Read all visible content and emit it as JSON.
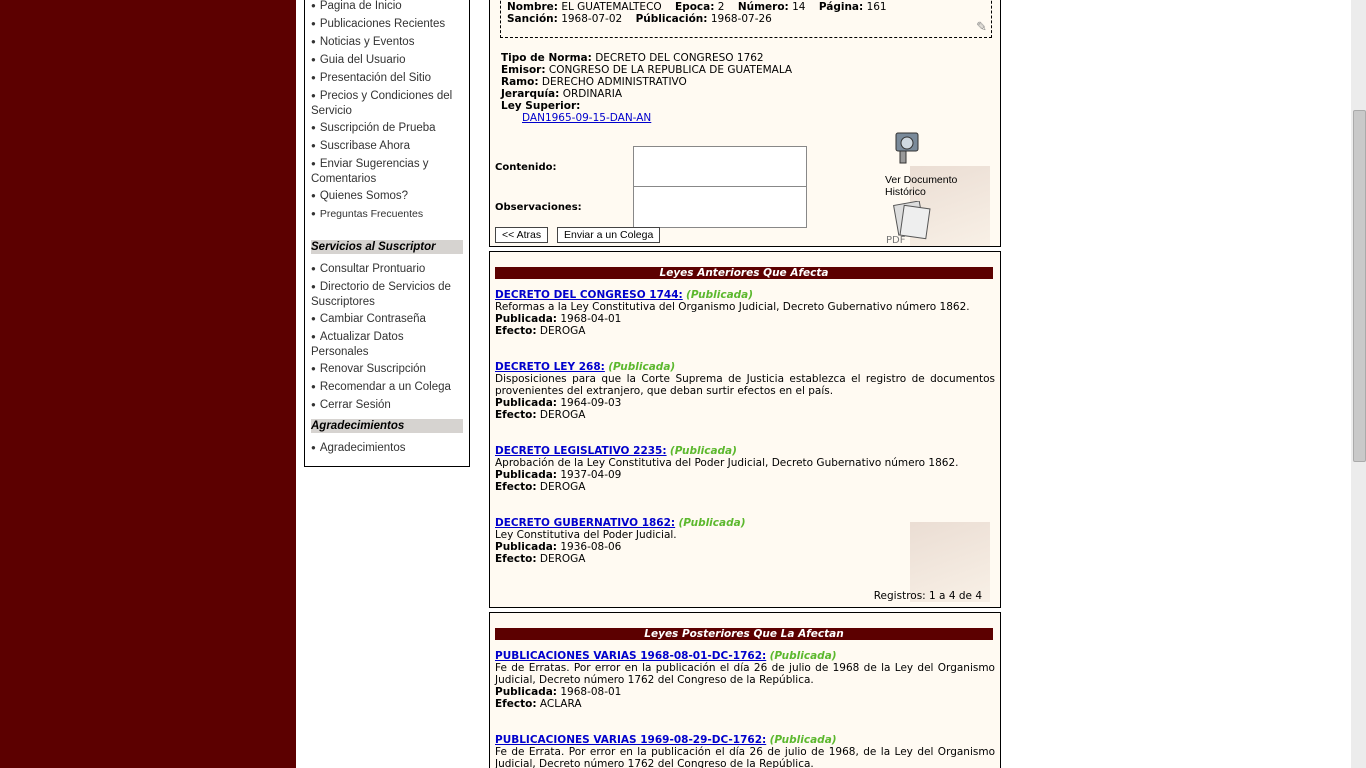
{
  "sidebar": {
    "menu1": [
      {
        "label": "Pagina de Inicio"
      },
      {
        "label": "Publicaciones Recientes"
      },
      {
        "label": "Noticias y Eventos"
      },
      {
        "label": "Guia del Usuario"
      },
      {
        "label": "Presentación del Sitio"
      },
      {
        "label": "Precios y Condiciones del Servicio"
      },
      {
        "label": "Suscripción de Prueba"
      },
      {
        "label": "Suscribase Ahora"
      },
      {
        "label": "Enviar Sugerencias y Comentarios"
      },
      {
        "label": "Quienes Somos?"
      },
      {
        "label": "Preguntas Frecuentes"
      }
    ],
    "heading2": "Servicios al Suscriptor",
    "menu2": [
      {
        "label": "Consultar Prontuario"
      },
      {
        "label": "Directorio de Servicios de Suscriptores"
      },
      {
        "label": "Cambiar Contraseña"
      },
      {
        "label": "Actualizar Datos Personales"
      },
      {
        "label": "Renovar Suscripción"
      },
      {
        "label": "Recomendar a un Colega"
      },
      {
        "label": "Cerrar Sesión"
      }
    ],
    "heading3": "Agradecimientos",
    "menu3": [
      {
        "label": "Agradecimientos"
      }
    ]
  },
  "doc": {
    "nombre_label": "Nombre:",
    "nombre": "EL GUATEMALTECO",
    "epoca_label": "Epoca:",
    "epoca": "2",
    "numero_label": "Número:",
    "numero": "14",
    "pagina_label": "Página:",
    "pagina": "161",
    "sancion_label": "Sanción:",
    "sancion": "1968-07-02",
    "publicacion_label": "Públicación:",
    "publicacion": "1968-07-26",
    "tipo_label": "Tipo de Norma:",
    "tipo": "DECRETO DEL CONGRESO 1762",
    "emisor_label": "Emisor:",
    "emisor": "CONGRESO DE LA REPUBLICA DE GUATEMALA",
    "ramo_label": "Ramo:",
    "ramo": "DERECHO ADMINISTRATIVO",
    "jerarquia_label": "Jerarquía:",
    "jerarquia": "ORDINARIA",
    "ley_superior_label": "Ley Superior:",
    "ley_superior_link": "DAN1965-09-15-DAN-AN",
    "contenido_label": "Contenido:",
    "observaciones_label": "Observaciones:",
    "atras_button": "<< Atras",
    "enviar_button": "Enviar a un Colega",
    "ver_documento": "Ver Documento Histórico"
  },
  "anteriores": {
    "heading": "Leyes Anteriores Que Afecta",
    "items": [
      {
        "title": "DECRETO DEL CONGRESO 1744:",
        "status": "(Publicada)",
        "desc": "Reformas a la Ley Constitutiva del Organismo Judicial, Decreto Gubernativo número 1862.",
        "publicada": "1968-04-01",
        "efecto": "DEROGA"
      },
      {
        "title": "DECRETO LEY 268:",
        "status": "(Publicada)",
        "desc": "Disposiciones para que la Corte Suprema de Justicia establezca el registro de documentos provenientes del extranjero, que deban surtir efectos en el país.",
        "publicada": "1964-09-03",
        "efecto": "DEROGA"
      },
      {
        "title": "DECRETO LEGISLATIVO 2235:",
        "status": "(Publicada)",
        "desc": "Aprobación de la Ley Constitutiva del Poder Judicial, Decreto Gubernativo número 1862.",
        "publicada": "1937-04-09",
        "efecto": "DEROGA"
      },
      {
        "title": "DECRETO GUBERNATIVO 1862:",
        "status": "(Publicada)",
        "desc": "Ley Constitutiva del Poder Judicial.",
        "publicada": "1936-08-06",
        "efecto": "DEROGA"
      }
    ],
    "publicada_label": "Publicada:",
    "efecto_label": "Efecto:",
    "registros": "Registros: 1 a 4 de 4"
  },
  "posteriores": {
    "heading": "Leyes Posteriores Que La Afectan",
    "items": [
      {
        "title": "PUBLICACIONES VARIAS 1968-08-01-DC-1762:",
        "status": "(Publicada)",
        "desc": "Fe de Erratas. Por error en la publicación el día 26 de julio de 1968 de la Ley del Organismo Judicial, Decreto número 1762 del Congreso de la República.",
        "publicada": "1968-08-01",
        "efecto": "ACLARA"
      },
      {
        "title": "PUBLICACIONES VARIAS 1969-08-29-DC-1762:",
        "status": "(Publicada)",
        "desc": "Fe de Errata. Por error en la publicación el día 26 de julio de 1968, de la Ley del Organismo Judicial, Decreto número 1762 del Congreso de la República."
      }
    ]
  },
  "colors": {
    "maroon": "#5c0000",
    "panel_bg": "#fffaf2",
    "link": "#0000cc",
    "published": "#5cb82e"
  }
}
